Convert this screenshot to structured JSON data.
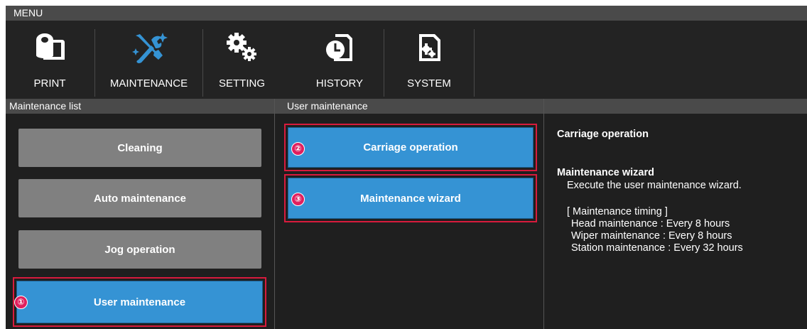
{
  "menu_title": "MENU",
  "toolbar": {
    "items": [
      {
        "label": "PRINT",
        "icon": "print-icon"
      },
      {
        "label": "MAINTENANCE",
        "icon": "maintenance-tools-icon",
        "icon_color": "#3593d4"
      },
      {
        "label": "SETTING",
        "icon": "gears-icon"
      },
      {
        "label": "HISTORY",
        "icon": "history-clock-icon"
      },
      {
        "label": "SYSTEM",
        "icon": "system-document-gear-icon"
      }
    ]
  },
  "maintenance_list": {
    "header": "Maintenance list",
    "items": [
      {
        "label": "Cleaning"
      },
      {
        "label": "Auto maintenance"
      },
      {
        "label": "Jog operation"
      },
      {
        "label": "User maintenance",
        "marker": "①",
        "selected": true
      }
    ]
  },
  "user_maintenance": {
    "header": "User maintenance",
    "items": [
      {
        "label": "Carriage operation",
        "marker": "②"
      },
      {
        "label": "Maintenance wizard",
        "marker": "③"
      }
    ]
  },
  "description": {
    "title": "Carriage operation",
    "subtitle": "Maintenance wizard",
    "text": "Execute the user maintenance wizard.",
    "timing_header": "[ Maintenance timing ]",
    "timing": [
      "Head maintenance : Every 8 hours",
      "Wiper maintenance : Every 8 hours",
      "Station maintenance : Every 32 hours"
    ]
  },
  "colors": {
    "accent_blue": "#3593d4",
    "highlight_red": "#d81b3d",
    "marker_magenta": "#e0205e",
    "inactive_gray": "#808080"
  }
}
